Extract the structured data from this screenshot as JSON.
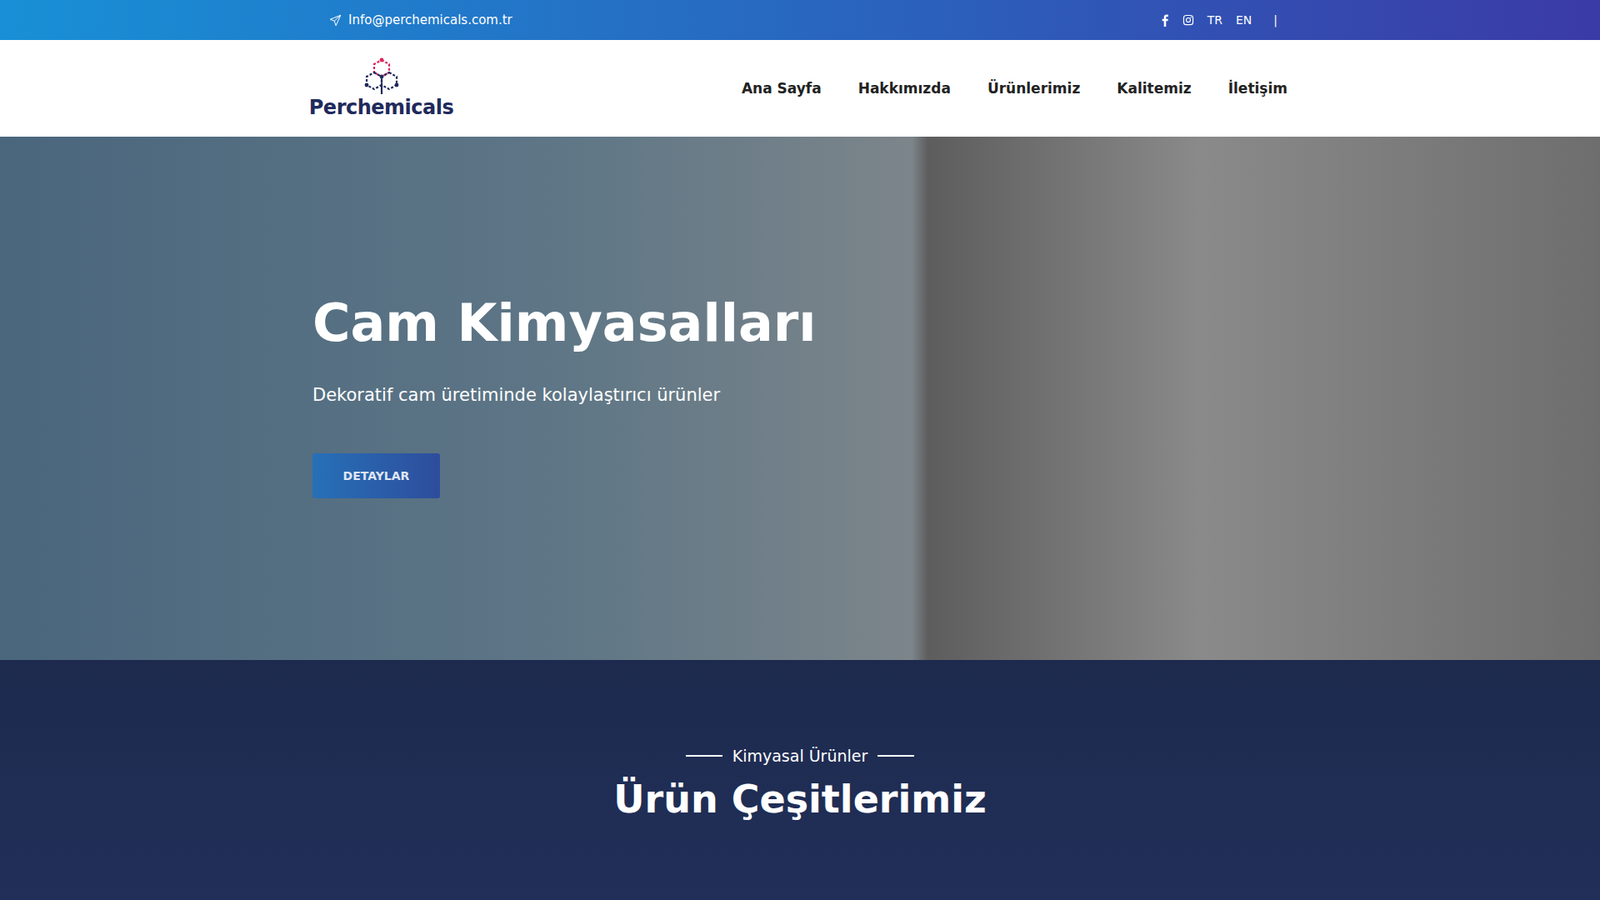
{
  "topbar": {
    "email": "Info@perchemicals.com.tr",
    "languages": [
      "TR",
      "EN"
    ],
    "separator": "|"
  },
  "logo": {
    "text": "Perchemicals"
  },
  "nav": {
    "items": [
      "Ana Sayfa",
      "Hakkımızda",
      "Ürünlerimiz",
      "Kalitemiz",
      "İletişim"
    ]
  },
  "hero": {
    "title": "Cam Kimyasalları",
    "subtitle": "Dekoratif cam üretiminde kolaylaştırıcı ürünler",
    "button": "DETAYLAR"
  },
  "products": {
    "eyebrow": "Kimyasal Ürünler",
    "title": "Ürün Çeşitlerimiz"
  }
}
